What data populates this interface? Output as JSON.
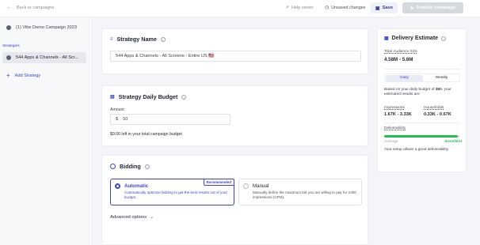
{
  "topbar": {
    "back_label": "Back to campaigns",
    "help_label": "Help center",
    "unsaved_label": "Unsaved changes",
    "save_label": "Save",
    "publish_label": "Publish campaign"
  },
  "sidebar": {
    "campaign_name": "(1) Vibe Demo Campaign 2023",
    "strategies_heading": "Strategies",
    "strategy_item": "544 Apps & Channels - All Scr...",
    "add_strategy": "Add Strategy"
  },
  "strategy_name": {
    "title": "Strategy Name",
    "value": "544 Apps & Channels - All Screens - Entire US 🇺🇸"
  },
  "budget": {
    "title": "Strategy Daily Budget",
    "amount_label": "Amount",
    "currency": "$",
    "amount_value": "50",
    "left_text": "$0.00 left in your total campaign budget"
  },
  "bidding": {
    "title": "Bidding",
    "automatic": {
      "title": "Automatic",
      "desc": "Automatically optimize bidding to get the best results out of your budget.",
      "badge": "Recommended"
    },
    "manual": {
      "title": "Manual",
      "desc": "Manually define the maximum bid you are willing to pay for 1000 impressions (CPM)."
    },
    "advanced": "Advanced options"
  },
  "delivery": {
    "title": "Delivery Estimate",
    "audience_label": "Total Audience Size",
    "audience_value": "4.58M - 5.6M",
    "toggle_daily": "Daily",
    "toggle_weekly": "Weekly",
    "budget_text_1": "Based on your daily budget of",
    "budget_amount": "$50",
    "budget_text_2": ", your estimated results are:",
    "impressions_label": "Impressions",
    "impressions_value": "1.67K - 3.33K",
    "households_label": "Households",
    "households_value": "0.33K - 0.67K",
    "deliverability_label": "Deliverability",
    "deliverability_fraction": 0.97,
    "average_label": "Average",
    "excellent_label": "Excellent",
    "setup_text": "Your setup allows a good deliverability"
  },
  "colors": {
    "accent": "#3d44c9",
    "green": "#1fbf56"
  }
}
